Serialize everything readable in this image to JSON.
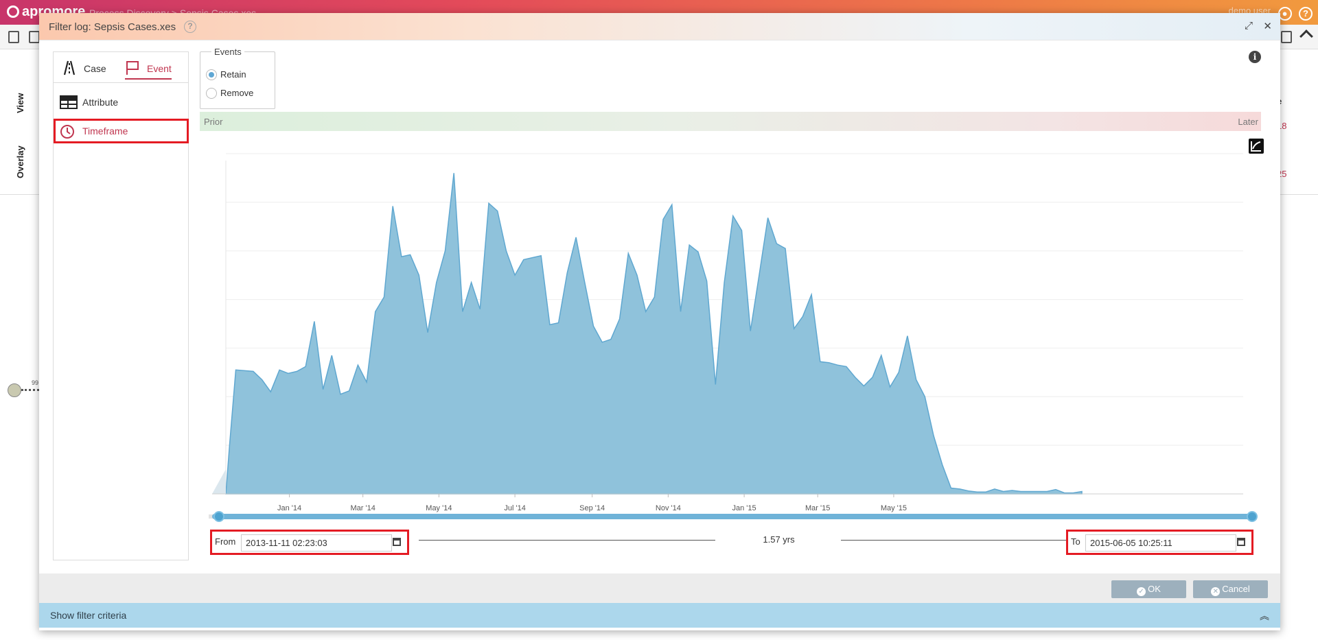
{
  "app": {
    "brand": "apromore",
    "breadcrumb": "Process Discovery  >  Sepsis Cases.xes",
    "user": "demo user"
  },
  "background": {
    "side_tabs": [
      "View",
      "Overlay"
    ],
    "right_header": "e",
    "right_values": [
      "18",
      "25"
    ],
    "node_count": "99"
  },
  "modal": {
    "title": "Filter log: Sepsis Cases.xes",
    "help": "?",
    "expand": "⤢",
    "close": "✕",
    "tabs": [
      {
        "label": "Case"
      },
      {
        "label": "Event"
      }
    ],
    "nav": [
      {
        "label": "Attribute"
      },
      {
        "label": "Timeframe"
      }
    ],
    "events": {
      "legend": "Events",
      "options": [
        "Retain",
        "Remove"
      ],
      "selected": "Retain"
    },
    "info": "i",
    "range_labels": {
      "prior": "Prior",
      "later": "Later"
    },
    "from": {
      "label": "From",
      "value": "2013-11-11 02:23:03"
    },
    "to": {
      "label": "To",
      "value": "2015-06-05 10:25:11"
    },
    "duration": "1.57 yrs",
    "slider": {
      "start_fraction": 0.0,
      "end_fraction": 1.0
    },
    "buttons": {
      "ok": "OK",
      "cancel": "Cancel"
    },
    "criteria": "Show filter criteria"
  },
  "colors": {
    "accent": "#c0354f",
    "area_fill": "#8fc2db",
    "area_stroke": "#5fa7d0",
    "highlight": "#e41b23",
    "button": "#9db0bd"
  },
  "chart_data": {
    "type": "area",
    "x_start": "2013-11-11",
    "x_end": "2015-06-05",
    "xticks": [
      {
        "label": "Jan '14",
        "date": "2014-01-01"
      },
      {
        "label": "Mar '14",
        "date": "2014-03-01"
      },
      {
        "label": "May '14",
        "date": "2014-05-01"
      },
      {
        "label": "Jul '14",
        "date": "2014-07-01"
      },
      {
        "label": "Sep '14",
        "date": "2014-09-01"
      },
      {
        "label": "Nov '14",
        "date": "2014-11-01"
      },
      {
        "label": "Jan '15",
        "date": "2015-01-01"
      },
      {
        "label": "Mar '15",
        "date": "2015-03-01"
      },
      {
        "label": "May '15",
        "date": "2015-05-01"
      }
    ],
    "ylim": [
      0,
      7
    ],
    "grid": true,
    "series": [
      {
        "points": [
          [
            "2013-11-11",
            0.0
          ],
          [
            "2013-11-14",
            1.0
          ],
          [
            "2013-11-19",
            2.55
          ],
          [
            "2013-12-03",
            2.52
          ],
          [
            "2013-12-10",
            2.35
          ],
          [
            "2013-12-17",
            2.1
          ],
          [
            "2013-12-24",
            2.55
          ],
          [
            "2013-12-31",
            2.48
          ],
          [
            "2014-01-07",
            2.52
          ],
          [
            "2014-01-14",
            2.62
          ],
          [
            "2014-01-21",
            3.55
          ],
          [
            "2014-01-28",
            2.15
          ],
          [
            "2014-02-04",
            2.85
          ],
          [
            "2014-02-11",
            2.05
          ],
          [
            "2014-02-18",
            2.12
          ],
          [
            "2014-02-25",
            2.65
          ],
          [
            "2014-03-04",
            2.3
          ],
          [
            "2014-03-11",
            3.75
          ],
          [
            "2014-03-18",
            4.05
          ],
          [
            "2014-03-25",
            5.92
          ],
          [
            "2014-04-01",
            4.88
          ],
          [
            "2014-04-08",
            4.92
          ],
          [
            "2014-04-15",
            4.5
          ],
          [
            "2014-04-22",
            3.32
          ],
          [
            "2014-04-29",
            4.35
          ],
          [
            "2014-05-06",
            5.0
          ],
          [
            "2014-05-13",
            6.6
          ],
          [
            "2014-05-20",
            3.75
          ],
          [
            "2014-05-27",
            4.35
          ],
          [
            "2014-06-03",
            3.8
          ],
          [
            "2014-06-10",
            5.98
          ],
          [
            "2014-06-17",
            5.82
          ],
          [
            "2014-06-24",
            5.0
          ],
          [
            "2014-07-01",
            4.5
          ],
          [
            "2014-07-08",
            4.82
          ],
          [
            "2014-07-15",
            4.86
          ],
          [
            "2014-07-22",
            4.9
          ],
          [
            "2014-07-29",
            3.48
          ],
          [
            "2014-08-05",
            3.52
          ],
          [
            "2014-08-12",
            4.55
          ],
          [
            "2014-08-19",
            5.28
          ],
          [
            "2014-08-26",
            4.35
          ],
          [
            "2014-09-02",
            3.45
          ],
          [
            "2014-09-09",
            3.12
          ],
          [
            "2014-09-16",
            3.18
          ],
          [
            "2014-09-23",
            3.6
          ],
          [
            "2014-09-30",
            4.95
          ],
          [
            "2014-10-07",
            4.5
          ],
          [
            "2014-10-14",
            3.75
          ],
          [
            "2014-10-21",
            4.05
          ],
          [
            "2014-10-28",
            5.65
          ],
          [
            "2014-11-04",
            5.95
          ],
          [
            "2014-11-11",
            3.75
          ],
          [
            "2014-11-18",
            5.12
          ],
          [
            "2014-11-25",
            4.98
          ],
          [
            "2014-12-02",
            4.38
          ],
          [
            "2014-12-09",
            2.25
          ],
          [
            "2014-12-16",
            4.35
          ],
          [
            "2014-12-23",
            5.72
          ],
          [
            "2014-12-30",
            5.42
          ],
          [
            "2015-01-06",
            3.35
          ],
          [
            "2015-01-13",
            4.5
          ],
          [
            "2015-01-20",
            5.68
          ],
          [
            "2015-01-27",
            5.15
          ],
          [
            "2015-02-03",
            5.05
          ],
          [
            "2015-02-10",
            3.4
          ],
          [
            "2015-02-17",
            3.65
          ],
          [
            "2015-02-24",
            4.1
          ],
          [
            "2015-03-03",
            2.72
          ],
          [
            "2015-03-10",
            2.7
          ],
          [
            "2015-03-17",
            2.65
          ],
          [
            "2015-03-24",
            2.62
          ],
          [
            "2015-03-31",
            2.4
          ],
          [
            "2015-04-07",
            2.22
          ],
          [
            "2015-04-14",
            2.4
          ],
          [
            "2015-04-21",
            2.85
          ],
          [
            "2015-04-28",
            2.2
          ],
          [
            "2015-05-05",
            2.5
          ],
          [
            "2015-05-12",
            3.25
          ],
          [
            "2015-05-19",
            2.35
          ],
          [
            "2015-05-26",
            2.0
          ],
          [
            "2015-06-02",
            1.2
          ],
          [
            "2015-06-09",
            0.6
          ],
          [
            "2015-06-16",
            0.12
          ],
          [
            "2015-06-23",
            0.1
          ],
          [
            "2015-06-30",
            0.06
          ],
          [
            "2015-07-07",
            0.04
          ],
          [
            "2015-07-14",
            0.04
          ],
          [
            "2015-07-21",
            0.1
          ],
          [
            "2015-07-28",
            0.05
          ],
          [
            "2015-08-04",
            0.07
          ],
          [
            "2015-08-11",
            0.05
          ],
          [
            "2015-08-18",
            0.05
          ],
          [
            "2015-08-25",
            0.05
          ],
          [
            "2015-09-01",
            0.05
          ],
          [
            "2015-09-08",
            0.09
          ],
          [
            "2015-09-15",
            0.02
          ],
          [
            "2015-09-22",
            0.02
          ],
          [
            "2015-09-29",
            0.05
          ]
        ]
      }
    ]
  }
}
